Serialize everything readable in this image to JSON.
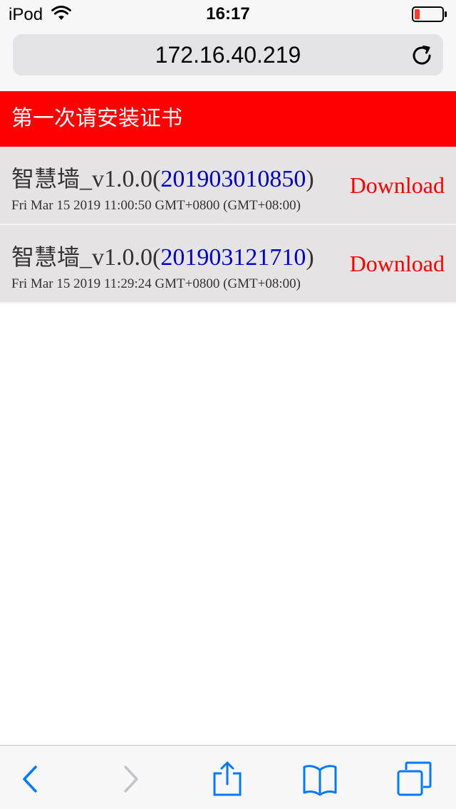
{
  "status_bar": {
    "device": "iPod",
    "time": "16:17"
  },
  "address_bar": {
    "url": "172.16.40.219"
  },
  "banner": {
    "text": "第一次请安装证书",
    "color": "#ff0000"
  },
  "items": [
    {
      "name": "智慧墙",
      "version": "_v1.0.0(",
      "build": "201903010850",
      "close": ")",
      "date": "Fri Mar 15 2019 11:00:50 GMT+0800 (GMT+08:00)",
      "action": "Download"
    },
    {
      "name": "智慧墙",
      "version": "_v1.0.0(",
      "build": "201903121710",
      "close": ")",
      "date": "Fri Mar 15 2019 11:29:24 GMT+0800 (GMT+08:00)",
      "action": "Download"
    }
  ],
  "toolbar": {
    "icons": [
      "back-icon",
      "forward-icon",
      "share-icon",
      "bookmarks-icon",
      "tabs-icon"
    ],
    "accent": "#007aff"
  }
}
